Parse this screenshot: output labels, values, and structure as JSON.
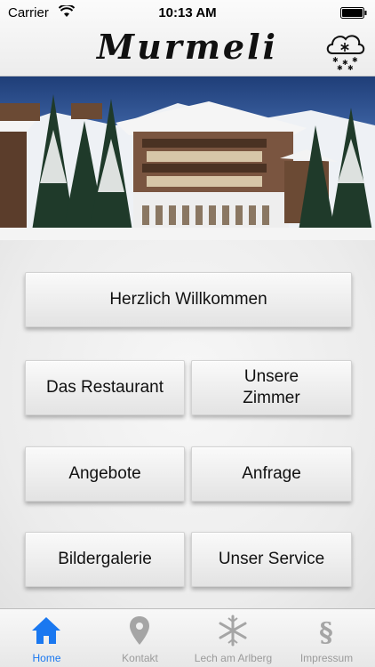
{
  "status_bar": {
    "carrier": "Carrier",
    "time": "10:13 AM"
  },
  "header": {
    "logo_text": "Murmeli",
    "weather_icon": "snow-cloud-icon"
  },
  "buttons": {
    "welcome": "Herzlich Willkommen",
    "restaurant": "Das Restaurant",
    "rooms": "Unsere Zimmer",
    "offers": "Angebote",
    "inquiry": "Anfrage",
    "gallery": "Bildergalerie",
    "service": "Unser Service"
  },
  "tabbar": {
    "tabs": [
      {
        "label": "Home",
        "icon": "home-icon",
        "active": true
      },
      {
        "label": "Kontakt",
        "icon": "location-pin-icon",
        "active": false
      },
      {
        "label": "Lech am Arlberg",
        "icon": "snowflake-icon",
        "active": false
      },
      {
        "label": "Impressum",
        "icon": "paragraph-icon",
        "active": false
      }
    ]
  },
  "colors": {
    "active_tab": "#1a78f0",
    "inactive_tab": "#9b9b9b"
  }
}
